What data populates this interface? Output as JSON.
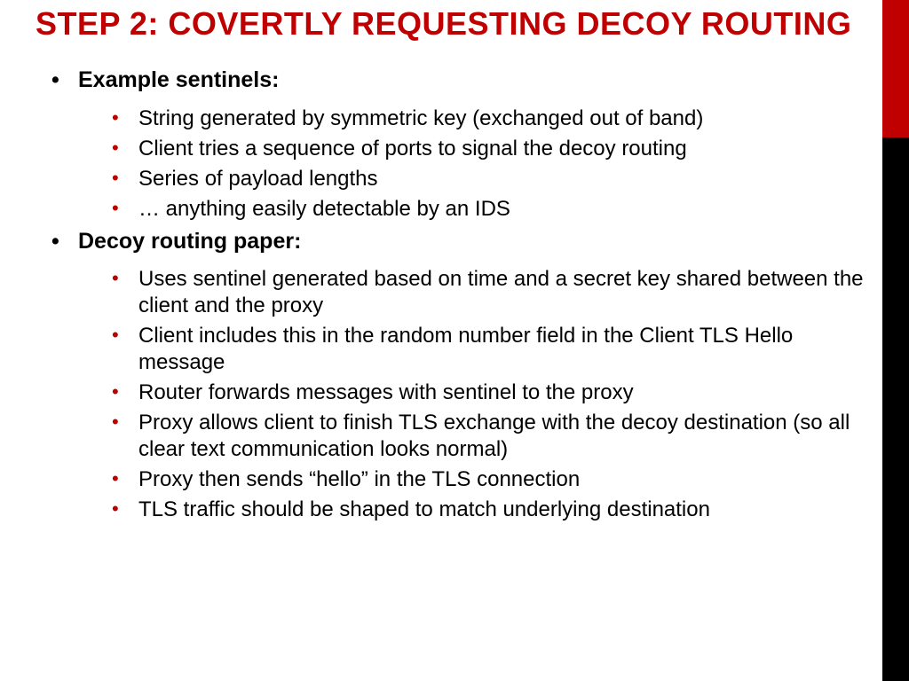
{
  "title": "STEP 2: COVERTLY REQUESTING DECOY ROUTING",
  "colors": {
    "accent": "#c00000",
    "stripe_black": "#000000"
  },
  "sections": [
    {
      "label": "Example sentinels:",
      "items": [
        "String generated by symmetric key (exchanged out of band)",
        "Client tries a sequence of ports to signal the decoy routing",
        "Series of payload lengths",
        "… anything easily detectable by an IDS"
      ]
    },
    {
      "label": "Decoy routing paper:",
      "items": [
        "Uses sentinel generated based on time and a secret key shared between the client and the proxy",
        "Client includes this in the random number field in the Client TLS Hello message",
        "Router forwards messages with sentinel to the proxy",
        "Proxy allows client to finish TLS exchange with the decoy destination (so all clear text communication looks normal)",
        "Proxy then sends “hello” in the TLS connection",
        "TLS traffic should be shaped to match underlying destination"
      ]
    }
  ]
}
